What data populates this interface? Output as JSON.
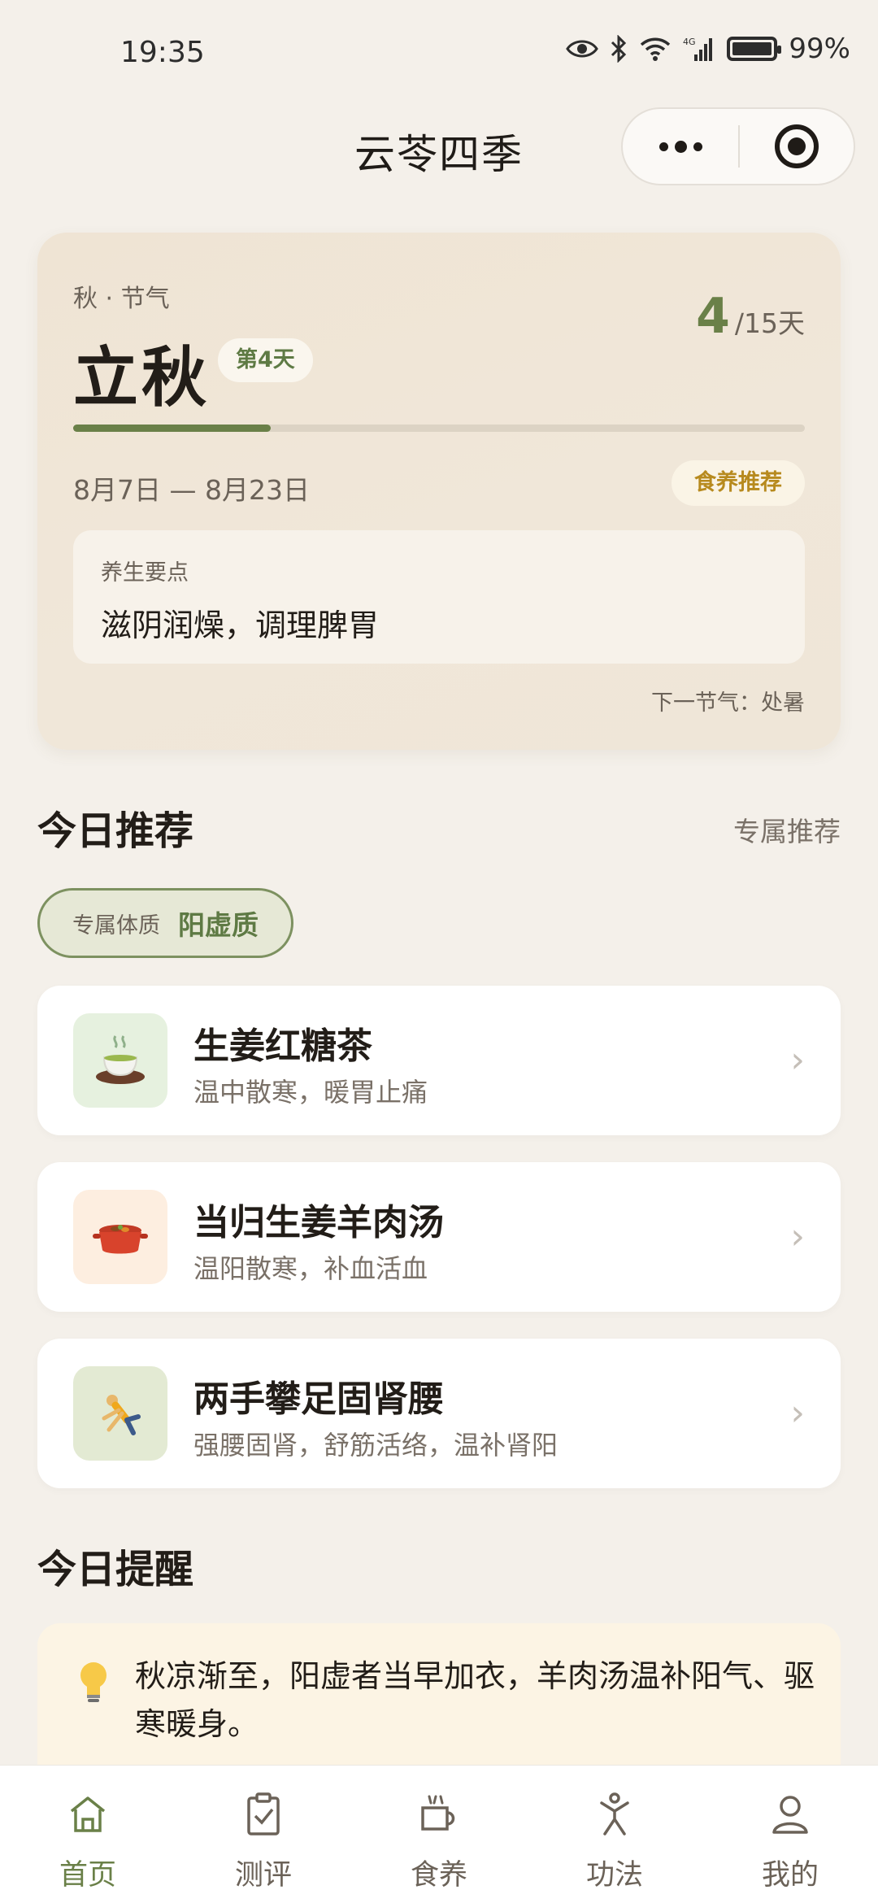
{
  "status_bar": {
    "time": "19:35",
    "battery": "99%",
    "network": "4G"
  },
  "header": {
    "title": "云苓四季"
  },
  "term_card": {
    "season": "秋 · 节气",
    "name": "立秋",
    "day_badge": "第4天",
    "day_current": "4",
    "day_total": "/15天",
    "progress": 0.27,
    "date_range": "8月7日 — 8月23日",
    "diet_chip": "食养推荐",
    "tip_label": "养生要点",
    "tip_text": "滋阴润燥，调理脾胃",
    "next_term": "下一节气：处暑"
  },
  "recommend": {
    "title": "今日推荐",
    "link": "专属推荐",
    "constitution_label": "专属体质",
    "constitution_value": "阳虚质",
    "items": [
      {
        "title": "生姜红糖茶",
        "desc": "温中散寒，暖胃止痛",
        "icon": "tea-icon"
      },
      {
        "title": "当归生姜羊肉汤",
        "desc": "温阳散寒，补血活血",
        "icon": "stew-pot-icon"
      },
      {
        "title": "两手攀足固肾腰",
        "desc": "强腰固肾，舒筋活络，温补肾阳",
        "icon": "exercise-icon"
      }
    ]
  },
  "reminder": {
    "title": "今日提醒",
    "text": "秋凉渐至，阳虚者当早加衣，羊肉汤温补阳气、驱寒暖身。"
  },
  "tabbar": {
    "items": [
      {
        "label": "首页",
        "icon": "home-icon"
      },
      {
        "label": "测评",
        "icon": "clipboard-check-icon"
      },
      {
        "label": "食养",
        "icon": "food-bowl-icon"
      },
      {
        "label": "功法",
        "icon": "figure-icon"
      },
      {
        "label": "我的",
        "icon": "user-icon"
      }
    ],
    "active_index": 0
  },
  "colors": {
    "accent": "#6a8048",
    "gold": "#b78a1e",
    "background": "#f4f0ea"
  }
}
